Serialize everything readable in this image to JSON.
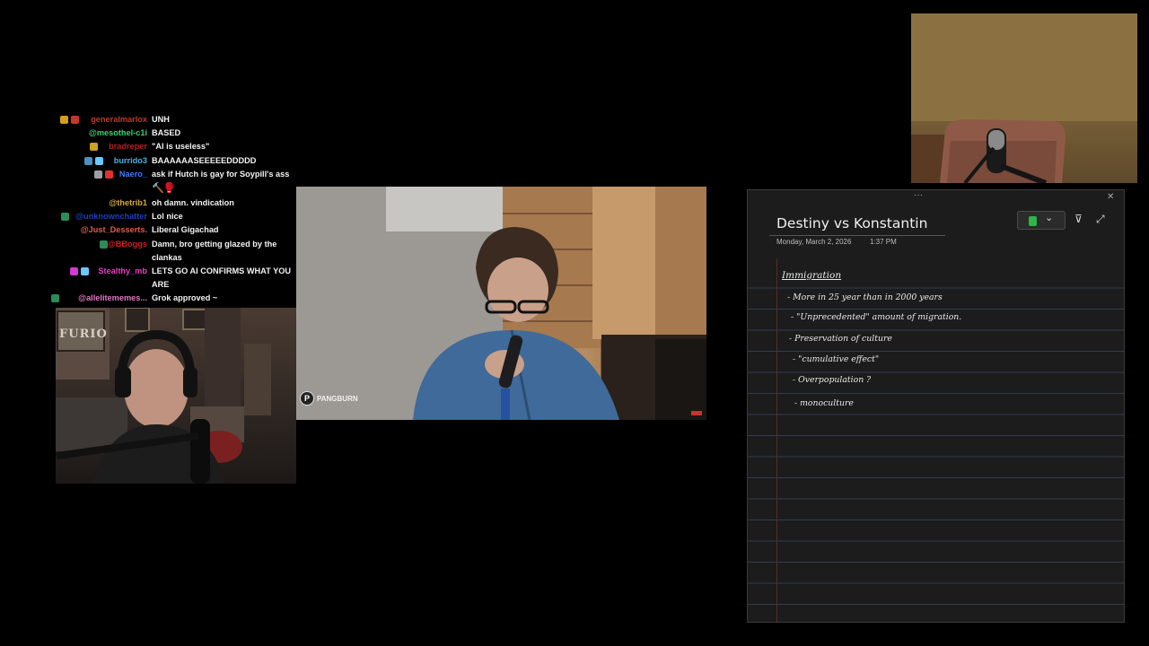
{
  "chat": {
    "messages": [
      {
        "user": "generalmarlox",
        "text": "UNH",
        "color": "#c0392b",
        "badges": [
          "#d4a017",
          "#c0392b"
        ]
      },
      {
        "user": "@mesothel-c1i",
        "text": "BASED",
        "color": "#3bd16f",
        "badges": []
      },
      {
        "user": "bradreper",
        "text": "\"AI is useless\"",
        "color": "#b22222",
        "badges": [
          "#c9a227"
        ]
      },
      {
        "user": "burrido3",
        "text": "BAAAAAASEEEEEDDDDD",
        "color": "#41b6e6",
        "badges": [
          "#4a90c2",
          "#6ec6ff"
        ]
      },
      {
        "user": "Naero_",
        "text": "ask if Hutch is gay for Soypill's ass",
        "color": "#3c7cff",
        "badges": [
          "#9aa0a6",
          "#e03131"
        ]
      },
      {
        "user": "",
        "text": "",
        "color": "#fff",
        "badges": [],
        "emote": "🔨🥊"
      },
      {
        "user": "@thetrib1",
        "text": "oh damn. vindication",
        "color": "#d4a93a",
        "badges": []
      },
      {
        "user": "@unknownchatter",
        "text": "Lol nice",
        "color": "#1f3fbf",
        "badges": [
          "#2e8b57"
        ]
      },
      {
        "user": "@Just_Desserts.",
        "text": "Liberal Gigachad",
        "color": "#e05b4b",
        "badges": []
      },
      {
        "user": "@BBoggs",
        "text": "Damn, bro getting glazed by the clankas",
        "color": "#d02020",
        "badges": [
          "#2e8b57"
        ]
      },
      {
        "user": "Stealthy_mb",
        "text": "LETS GO AI CONFIRMS WHAT YOU ARE",
        "color": "#e040c0",
        "badges": [
          "#d33ad3",
          "#6ec6ff"
        ]
      },
      {
        "user": "@allelitememes...",
        "text": "Grok approved ~",
        "color": "#e377c2",
        "badges": [
          "#2e8b57"
        ]
      }
    ]
  },
  "video": {
    "watermark": "PANGBURN"
  },
  "cam_left": {
    "poster_text": "FURIO"
  },
  "notes": {
    "title": "Destiny vs Konstantin",
    "date": "Monday, March 2, 2026",
    "time": "1:37 PM",
    "heading": "Immigration",
    "lines": [
      "- More in 25 year than in 2000 years",
      "- \"Unprecedented\" amount of migration.",
      "- Preservation of culture",
      "- \"cumulative effect\"",
      "- Overpopulation ?",
      "- monoculture"
    ],
    "accent": "#2fb34a",
    "drag_handle": "···",
    "close_glyph": "✕",
    "chevron_glyph": "⌄",
    "expand_glyph": "⤢",
    "pin_glyph": "⊽"
  }
}
